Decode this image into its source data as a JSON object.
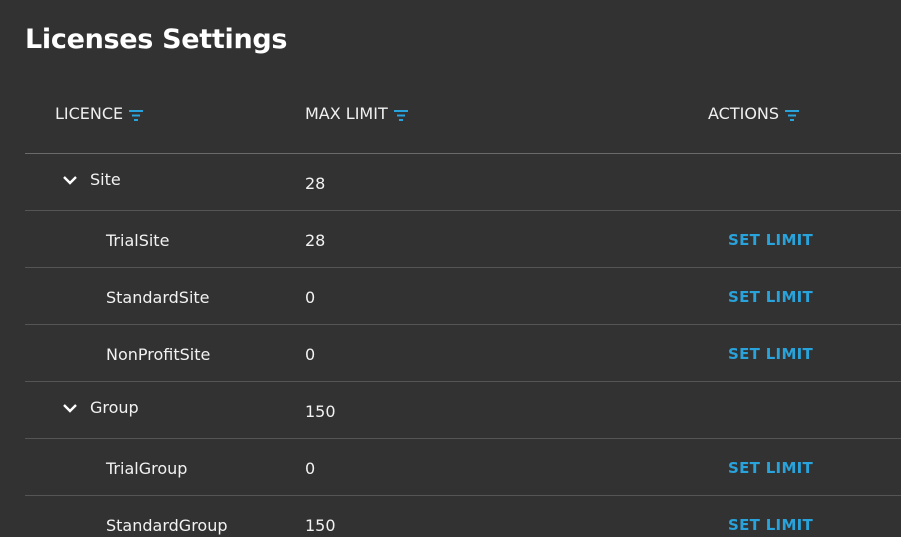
{
  "page": {
    "title": "Licenses Settings"
  },
  "columns": {
    "licence": "LICENCE",
    "max_limit": "MAX LIMIT",
    "actions": "ACTIONS"
  },
  "rows": [
    {
      "kind": "group",
      "name": "Site",
      "limit": "28",
      "action": ""
    },
    {
      "kind": "child",
      "name": "TrialSite",
      "limit": "28",
      "action": "SET LIMIT"
    },
    {
      "kind": "child",
      "name": "StandardSite",
      "limit": "0",
      "action": "SET LIMIT"
    },
    {
      "kind": "child",
      "name": "NonProfitSite",
      "limit": "0",
      "action": "SET LIMIT"
    },
    {
      "kind": "group",
      "name": "Group",
      "limit": "150",
      "action": ""
    },
    {
      "kind": "child",
      "name": "TrialGroup",
      "limit": "0",
      "action": "SET LIMIT"
    },
    {
      "kind": "child",
      "name": "StandardGroup",
      "limit": "150",
      "action": "SET LIMIT"
    }
  ],
  "colors": {
    "background": "#323232",
    "accent": "#29a3dc"
  },
  "icons": {
    "filter": "filter-icon",
    "expand": "chevron-down-icon"
  }
}
